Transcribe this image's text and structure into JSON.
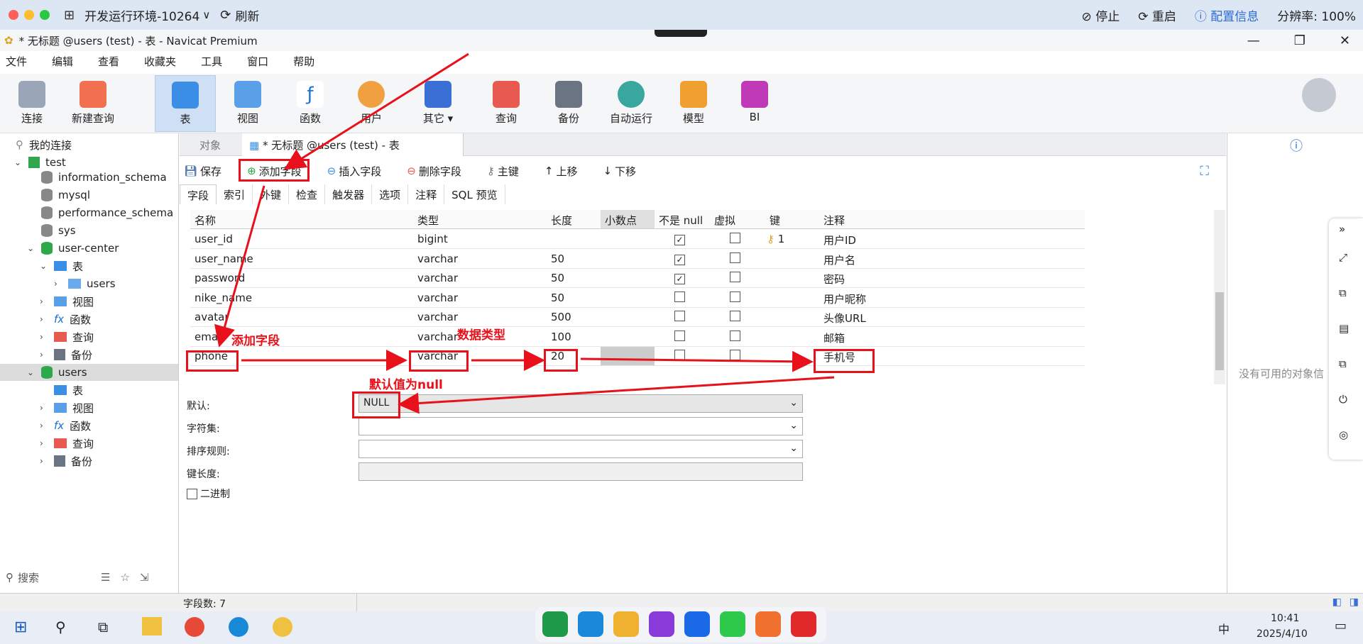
{
  "remote": {
    "env": "开发运行环境-10264",
    "refresh": "刷新",
    "stop": "停止",
    "restart": "重启",
    "config": "配置信息",
    "resolution": "分辨率: 100%"
  },
  "window": {
    "title": "* 无标题 @users (test) - 表 - Navicat Premium"
  },
  "menu": [
    "文件",
    "编辑",
    "查看",
    "收藏夹",
    "工具",
    "窗口",
    "帮助"
  ],
  "toolbar": [
    "连接",
    "新建查询",
    "表",
    "视图",
    "函数",
    "用户",
    "其它",
    "查询",
    "备份",
    "自动运行",
    "模型",
    "BI"
  ],
  "tree": {
    "my_conn": "我的连接",
    "test": "test",
    "dbs": [
      "information_schema",
      "mysql",
      "performance_schema",
      "sys"
    ],
    "uc": "user-center",
    "table": "表",
    "users_tbl": "users",
    "view": "视图",
    "func": "函数",
    "query": "查询",
    "backup": "备份",
    "users_db": "users",
    "search": "搜索"
  },
  "tabs": {
    "objects": "对象",
    "active": "* 无标题 @users (test) - 表"
  },
  "subtool": [
    "保存",
    "添加字段",
    "插入字段",
    "删除字段",
    "主键",
    "上移",
    "下移"
  ],
  "ftabs": [
    "字段",
    "索引",
    "外键",
    "检查",
    "触发器",
    "选项",
    "注释",
    "SQL 预览"
  ],
  "columns": [
    "名称",
    "类型",
    "长度",
    "小数点",
    "不是 null",
    "虚拟",
    "键",
    "注释"
  ],
  "rows": [
    {
      "name": "user_id",
      "type": "bigint",
      "len": "",
      "notnull": true,
      "key": "1",
      "comment": "用户ID"
    },
    {
      "name": "user_name",
      "type": "varchar",
      "len": "50",
      "notnull": true,
      "key": "",
      "comment": "用户名"
    },
    {
      "name": "password",
      "type": "varchar",
      "len": "50",
      "notnull": true,
      "key": "",
      "comment": "密码"
    },
    {
      "name": "nike_name",
      "type": "varchar",
      "len": "50",
      "notnull": false,
      "key": "",
      "comment": "用户昵称"
    },
    {
      "name": "avatar",
      "type": "varchar",
      "len": "500",
      "notnull": false,
      "key": "",
      "comment": "头像URL"
    },
    {
      "name": "email",
      "type": "varchar",
      "len": "100",
      "notnull": false,
      "key": "",
      "comment": "邮箱"
    },
    {
      "name": "phone",
      "type": "varchar",
      "len": "20",
      "notnull": false,
      "key": "",
      "comment": "手机号"
    }
  ],
  "props": {
    "default_label": "默认:",
    "default_val": "NULL",
    "charset": "字符集:",
    "collation": "排序规则:",
    "keylen": "键长度:",
    "binary": "二进制"
  },
  "right": {
    "empty": "没有可用的对象信"
  },
  "status": {
    "count": "字段数: 7"
  },
  "annotations": {
    "add": "添加字段",
    "dtype": "数据类型",
    "nullnote": "默认值为null"
  },
  "clock": {
    "time": "10:41",
    "date": "2025/4/10",
    "ime": "中"
  }
}
